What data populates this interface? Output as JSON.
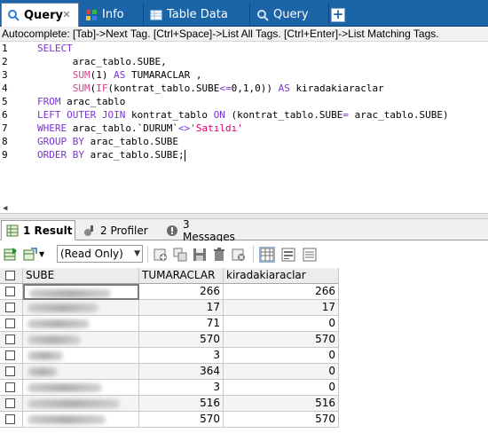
{
  "top_tabs": [
    {
      "label": "Query",
      "icon": "query-icon",
      "active": true
    },
    {
      "label": "Info",
      "icon": "info-icon",
      "active": false
    },
    {
      "label": "Table Data",
      "icon": "table-icon",
      "active": false
    },
    {
      "label": "Query",
      "icon": "query-icon",
      "active": false
    }
  ],
  "autocomplete_hint": "Autocomplete: [Tab]->Next Tag. [Ctrl+Space]->List All Tags. [Ctrl+Enter]->List Matching Tags.",
  "editor": {
    "line_numbers": [
      "1",
      "2",
      "3",
      "4",
      "5",
      "6",
      "7",
      "8",
      "9"
    ]
  },
  "result_tabs": [
    {
      "label": "1 Result",
      "active": true,
      "icon": "grid-icon"
    },
    {
      "label": "2 Profiler",
      "active": false,
      "icon": "profiler-icon"
    },
    {
      "label": "3 Messages",
      "active": false,
      "icon": "messages-icon"
    }
  ],
  "toolbar": {
    "mode_select": "(Read Only)"
  },
  "grid": {
    "columns": [
      "SUBE",
      "TUMARACLAR",
      "kiradakiaraclar"
    ],
    "rows": [
      {
        "tumaraclar": "266",
        "kiradaki": "266"
      },
      {
        "tumaraclar": "17",
        "kiradaki": "17"
      },
      {
        "tumaraclar": "71",
        "kiradaki": "0"
      },
      {
        "tumaraclar": "570",
        "kiradaki": "570"
      },
      {
        "tumaraclar": "3",
        "kiradaki": "0"
      },
      {
        "tumaraclar": "364",
        "kiradaki": "0"
      },
      {
        "tumaraclar": "3",
        "kiradaki": "0"
      },
      {
        "tumaraclar": "516",
        "kiradaki": "516"
      },
      {
        "tumaraclar": "570",
        "kiradaki": "570"
      }
    ]
  },
  "colors": {
    "tab_bar": "#1c64a8",
    "keyword": "#7a33d6",
    "function": "#d63c8f",
    "string": "#d60064"
  }
}
